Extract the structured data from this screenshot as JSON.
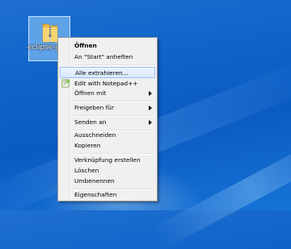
{
  "desktop": {
    "icon_label": "eclipse-jee-...-x86..."
  },
  "menu": {
    "items": [
      {
        "label": "Öffnen"
      },
      {
        "label": "An \"Start\" anheften"
      },
      {
        "label": "Alle extrahieren..."
      },
      {
        "label": "Edit with Notepad++",
        "icon": "notepad-plus-plus-icon"
      },
      {
        "label": "Öffnen mit",
        "submenu": true
      },
      {
        "label": "Freigeben für",
        "submenu": true
      },
      {
        "label": "Senden an",
        "submenu": true
      },
      {
        "label": "Ausschneiden"
      },
      {
        "label": "Kopieren"
      },
      {
        "label": "Verknüpfung erstellen"
      },
      {
        "label": "Löschen"
      },
      {
        "label": "Umbenennen"
      },
      {
        "label": "Eigenschaften"
      }
    ]
  },
  "colors": {
    "desktop_blue": "#0f63c8",
    "menu_background": "#f0f0f0",
    "highlight_border": "#9cc3f0"
  }
}
